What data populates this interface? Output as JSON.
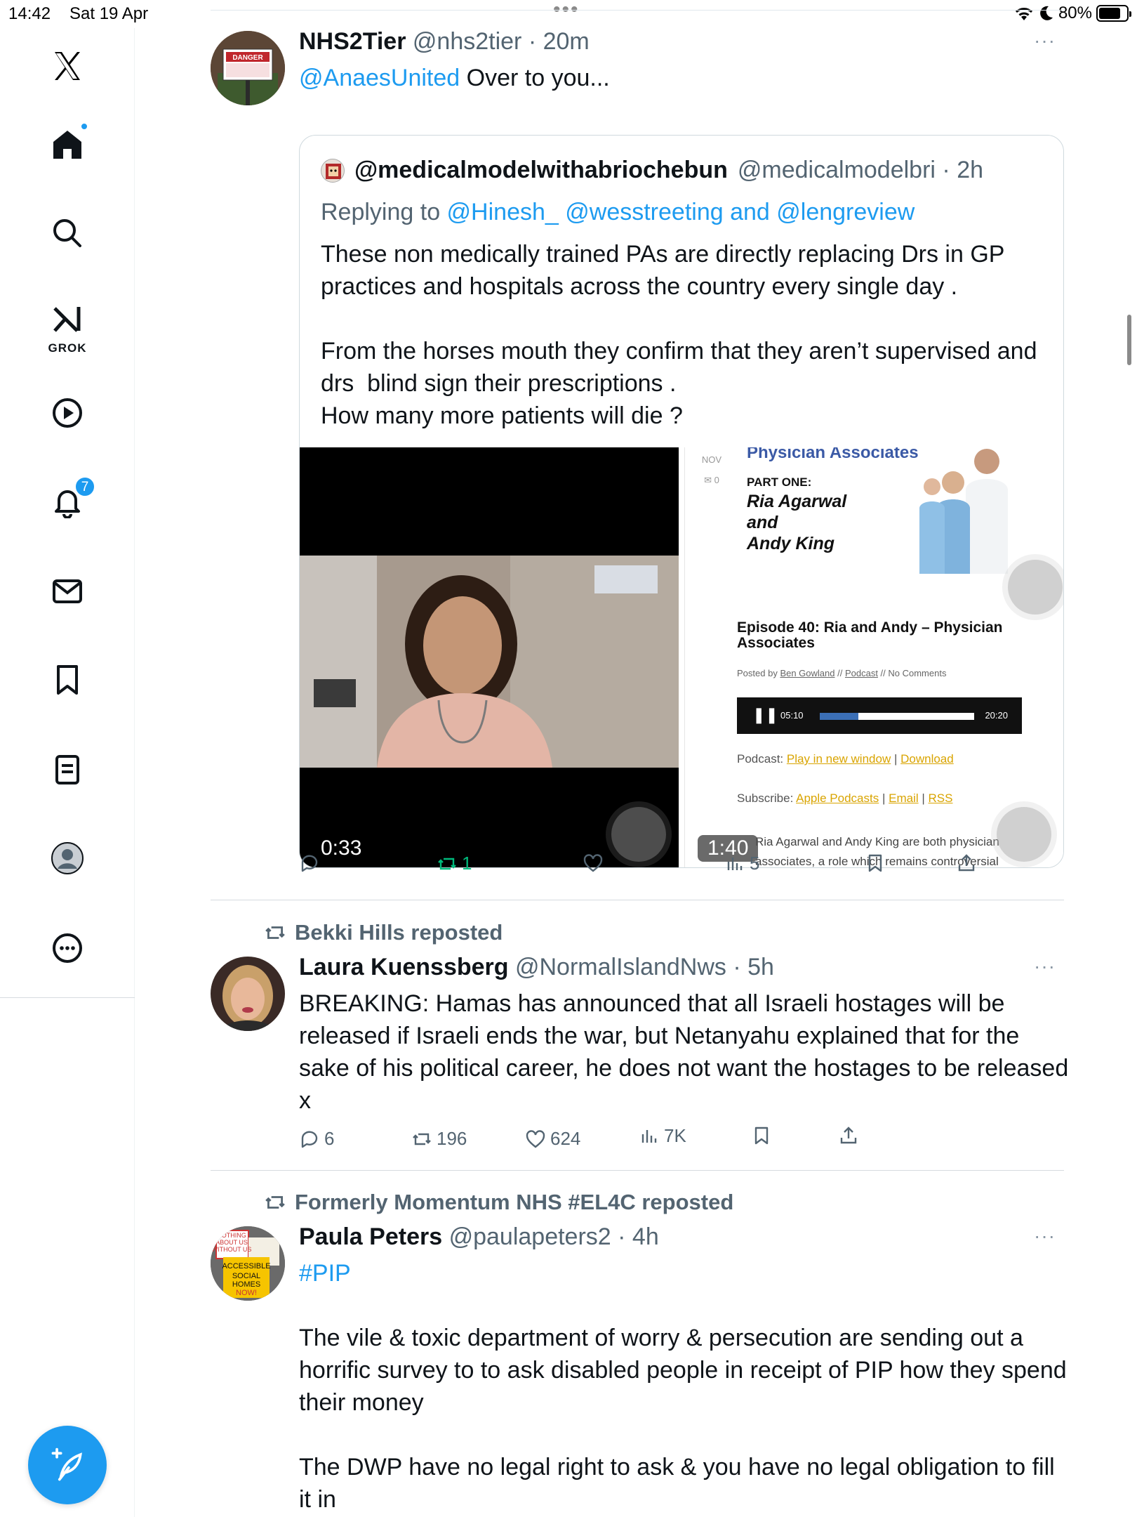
{
  "status_bar": {
    "time": "14:42",
    "date": "Sat 19 Apr",
    "battery": "80%",
    "battery_level": 0.8
  },
  "sidebar": {
    "badges": {
      "home_dot": true,
      "notifications": "7"
    },
    "grok_label": "GROK"
  },
  "posts": [
    {
      "name": "NHS2Tier",
      "handle": "@nhs2tier",
      "time": "20m",
      "mention": "@AnaesUnited",
      "text": " Over to you...",
      "quote": {
        "name": "@medicalmodelwithabriochebun",
        "handle": "@medicalmodelbri",
        "time": "2h",
        "replying_prefix": "Replying to ",
        "replying_to": "@Hinesh_ @wesstreeting and @lengreview",
        "text": "These non medically trained PAs are directly replacing Drs in GP practices and hospitals across the country every single day .\n\nFrom the horses mouth they confirm that they aren’t supervised and drs  blind sign their prescriptions .\nHow many more patients will die ?",
        "video1_duration": "0:33",
        "video2_duration": "1:40",
        "webpage": {
          "month": "NOV",
          "comments": "0",
          "title": "Physician Associates",
          "part": "PART ONE:",
          "guests": [
            "Ria Agarwal",
            "and",
            "Andy King"
          ],
          "episode": "Episode 40: Ria and Andy – Physician Associates",
          "posted_by": "Posted by ",
          "author": "Ben Gowland",
          "posted_sep": " // ",
          "category": "Podcast",
          "comments_text": " // No Comments",
          "player_time": "05:10",
          "player_total": "20:20",
          "player_progress": 0.25,
          "podcast_label": "Podcast: ",
          "podcast_links": [
            "Play in new window",
            "Download"
          ],
          "subscribe_label": "Subscribe: ",
          "subscribe_links": [
            "Apple Podcasts",
            "Email",
            "RSS"
          ],
          "link_sep": " | ",
          "description": "Ria Agarwal and Andy King are both physician associates, a role which remains controversial"
        }
      },
      "stats": {
        "reposts": "1",
        "views": "5"
      }
    },
    {
      "reposted_by": "Bekki Hills reposted",
      "name": "Laura Kuenssberg",
      "handle": "@NormalIslandNws",
      "time": "5h",
      "text": "BREAKING: Hamas has announced that all Israeli hostages will be released if Israeli ends the war, but Netanyahu explained that for the sake of his political career, he does not want the hostages to be released x",
      "stats": {
        "replies": "6",
        "reposts": "196",
        "likes": "624",
        "views": "7K"
      }
    },
    {
      "reposted_by": "Formerly Momentum NHS #EL4C reposted",
      "name": "Paula Peters",
      "handle": "@paulapeters2",
      "time": "4h",
      "hashtag": "#PIP",
      "text": "The vile & toxic department of worry & persecution are sending out a horrific survey to to ask disabled people in receipt of PIP how they spend their money\n\nThe DWP have no legal right to ask & you have no legal obligation to fill it in",
      "avatar_sign": [
        "NOTHING",
        "ABOUT US",
        "WITHOUT US",
        "ACCESSIBLE",
        "SOCIAL",
        "HOMES",
        "NOW!"
      ]
    }
  ],
  "dot_sep": " · ",
  "more_glyph": "···"
}
